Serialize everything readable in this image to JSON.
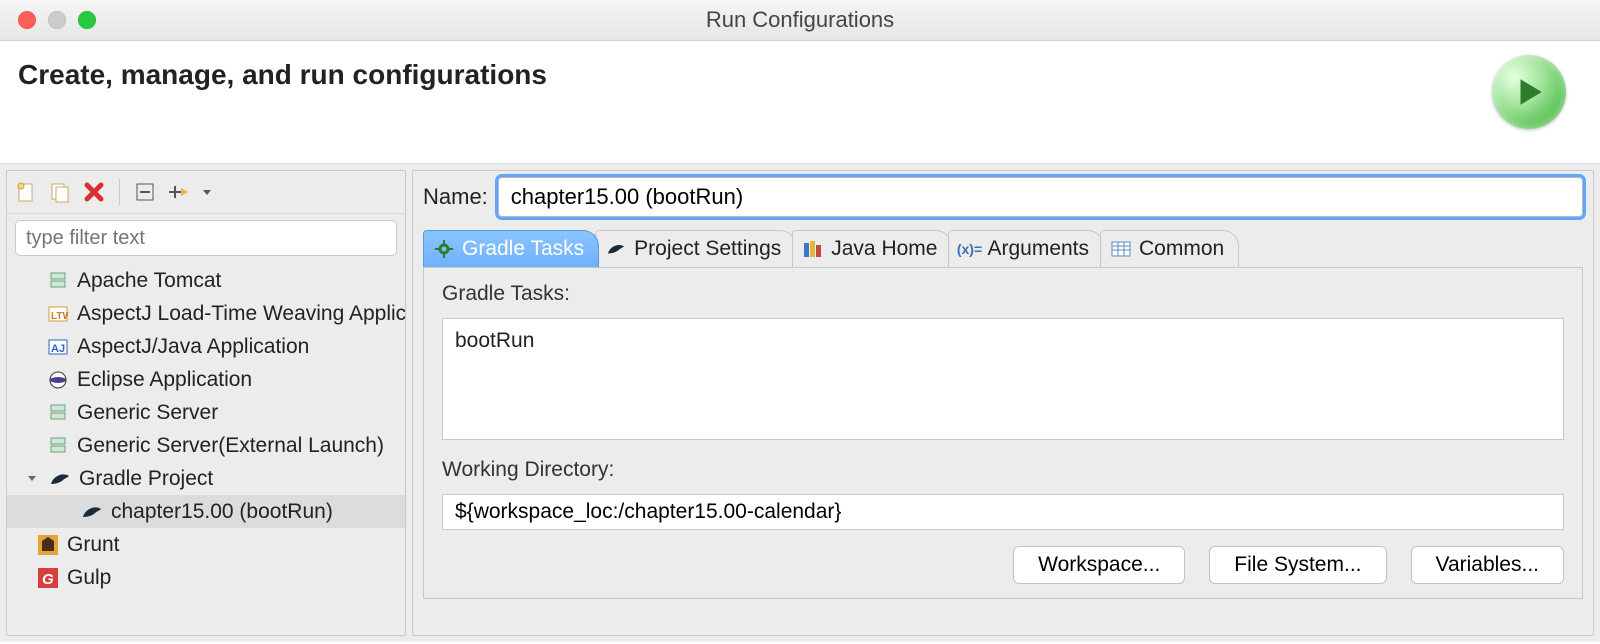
{
  "window": {
    "title": "Run Configurations"
  },
  "header": {
    "title": "Create, manage, and run configurations"
  },
  "filter": {
    "placeholder": "type filter text"
  },
  "tree": {
    "items": [
      {
        "label": "Apache Tomcat"
      },
      {
        "label": "AspectJ Load-Time Weaving Application"
      },
      {
        "label": "AspectJ/Java Application"
      },
      {
        "label": "Eclipse Application"
      },
      {
        "label": "Generic Server"
      },
      {
        "label": "Generic Server(External Launch)"
      }
    ],
    "gradle": {
      "label": "Gradle Project",
      "child": "chapter15.00 (bootRun)"
    },
    "grunt": "Grunt",
    "gulp": "Gulp"
  },
  "form": {
    "name_label": "Name:",
    "name_value": "chapter15.00 (bootRun)",
    "tabs": {
      "gradle": "Gradle Tasks",
      "project": "Project Settings",
      "java": "Java Home",
      "args": "Arguments",
      "common": "Common"
    },
    "gradle_section": {
      "tasks_label": "Gradle Tasks:",
      "tasks_value": "bootRun",
      "wd_label": "Working Directory:",
      "wd_value": "${workspace_loc:/chapter15.00-calendar}",
      "btn_workspace": "Workspace...",
      "btn_fs": "File System...",
      "btn_vars": "Variables..."
    }
  }
}
